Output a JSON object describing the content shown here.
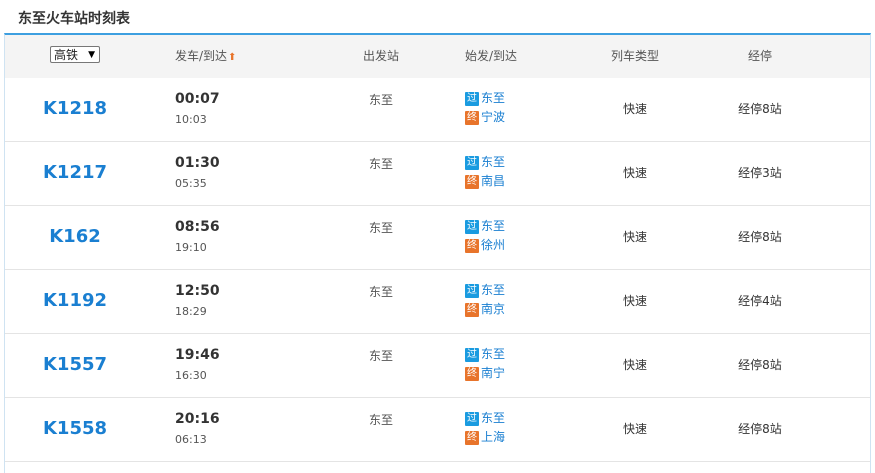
{
  "title": "东至火车站时刻表",
  "header": {
    "filter_select": "高铁",
    "col_depart_arrive": "发车/到达",
    "col_station": "出发站",
    "col_start_end": "始发/到达",
    "col_type": "列车类型",
    "col_stops": "经停"
  },
  "icons": {
    "sort": "sort-up-icon",
    "dropdown": "chevron-down-icon"
  },
  "colors": {
    "accent": "#1a7fd1",
    "pass_tag": "#1a9be0",
    "via_tag": "#e8742b",
    "header_rule": "#3d9fe0"
  },
  "rows": [
    {
      "train": "K1218",
      "dep": "00:07",
      "arr": "10:03",
      "station": "东至",
      "pass_tag": "过",
      "pass_station": "东至",
      "via_tag": "终",
      "via_station": "宁波",
      "type": "快速",
      "stops": "经停8站"
    },
    {
      "train": "K1217",
      "dep": "01:30",
      "arr": "05:35",
      "station": "东至",
      "pass_tag": "过",
      "pass_station": "东至",
      "via_tag": "终",
      "via_station": "南昌",
      "type": "快速",
      "stops": "经停3站"
    },
    {
      "train": "K162",
      "dep": "08:56",
      "arr": "19:10",
      "station": "东至",
      "pass_tag": "过",
      "pass_station": "东至",
      "via_tag": "终",
      "via_station": "徐州",
      "type": "快速",
      "stops": "经停8站"
    },
    {
      "train": "K1192",
      "dep": "12:50",
      "arr": "18:29",
      "station": "东至",
      "pass_tag": "过",
      "pass_station": "东至",
      "via_tag": "终",
      "via_station": "南京",
      "type": "快速",
      "stops": "经停4站"
    },
    {
      "train": "K1557",
      "dep": "19:46",
      "arr": "16:30",
      "station": "东至",
      "pass_tag": "过",
      "pass_station": "东至",
      "via_tag": "终",
      "via_station": "南宁",
      "type": "快速",
      "stops": "经停8站"
    },
    {
      "train": "K1558",
      "dep": "20:16",
      "arr": "06:13",
      "station": "东至",
      "pass_tag": "过",
      "pass_station": "东至",
      "via_tag": "终",
      "via_station": "上海",
      "type": "快速",
      "stops": "经停8站"
    }
  ]
}
